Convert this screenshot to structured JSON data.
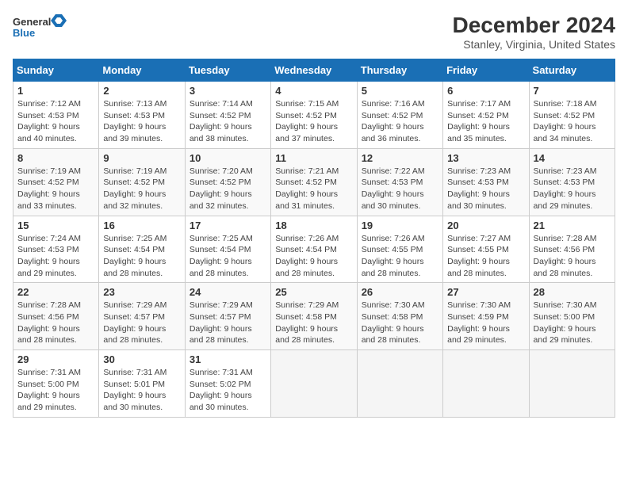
{
  "header": {
    "logo_line1": "General",
    "logo_line2": "Blue",
    "title": "December 2024",
    "subtitle": "Stanley, Virginia, United States"
  },
  "columns": [
    "Sunday",
    "Monday",
    "Tuesday",
    "Wednesday",
    "Thursday",
    "Friday",
    "Saturday"
  ],
  "weeks": [
    [
      {
        "day": "1",
        "sunrise": "7:12 AM",
        "sunset": "4:53 PM",
        "daylight": "9 hours and 40 minutes."
      },
      {
        "day": "2",
        "sunrise": "7:13 AM",
        "sunset": "4:53 PM",
        "daylight": "9 hours and 39 minutes."
      },
      {
        "day": "3",
        "sunrise": "7:14 AM",
        "sunset": "4:52 PM",
        "daylight": "9 hours and 38 minutes."
      },
      {
        "day": "4",
        "sunrise": "7:15 AM",
        "sunset": "4:52 PM",
        "daylight": "9 hours and 37 minutes."
      },
      {
        "day": "5",
        "sunrise": "7:16 AM",
        "sunset": "4:52 PM",
        "daylight": "9 hours and 36 minutes."
      },
      {
        "day": "6",
        "sunrise": "7:17 AM",
        "sunset": "4:52 PM",
        "daylight": "9 hours and 35 minutes."
      },
      {
        "day": "7",
        "sunrise": "7:18 AM",
        "sunset": "4:52 PM",
        "daylight": "9 hours and 34 minutes."
      }
    ],
    [
      {
        "day": "8",
        "sunrise": "7:19 AM",
        "sunset": "4:52 PM",
        "daylight": "9 hours and 33 minutes."
      },
      {
        "day": "9",
        "sunrise": "7:19 AM",
        "sunset": "4:52 PM",
        "daylight": "9 hours and 32 minutes."
      },
      {
        "day": "10",
        "sunrise": "7:20 AM",
        "sunset": "4:52 PM",
        "daylight": "9 hours and 32 minutes."
      },
      {
        "day": "11",
        "sunrise": "7:21 AM",
        "sunset": "4:52 PM",
        "daylight": "9 hours and 31 minutes."
      },
      {
        "day": "12",
        "sunrise": "7:22 AM",
        "sunset": "4:53 PM",
        "daylight": "9 hours and 30 minutes."
      },
      {
        "day": "13",
        "sunrise": "7:23 AM",
        "sunset": "4:53 PM",
        "daylight": "9 hours and 30 minutes."
      },
      {
        "day": "14",
        "sunrise": "7:23 AM",
        "sunset": "4:53 PM",
        "daylight": "9 hours and 29 minutes."
      }
    ],
    [
      {
        "day": "15",
        "sunrise": "7:24 AM",
        "sunset": "4:53 PM",
        "daylight": "9 hours and 29 minutes."
      },
      {
        "day": "16",
        "sunrise": "7:25 AM",
        "sunset": "4:54 PM",
        "daylight": "9 hours and 28 minutes."
      },
      {
        "day": "17",
        "sunrise": "7:25 AM",
        "sunset": "4:54 PM",
        "daylight": "9 hours and 28 minutes."
      },
      {
        "day": "18",
        "sunrise": "7:26 AM",
        "sunset": "4:54 PM",
        "daylight": "9 hours and 28 minutes."
      },
      {
        "day": "19",
        "sunrise": "7:26 AM",
        "sunset": "4:55 PM",
        "daylight": "9 hours and 28 minutes."
      },
      {
        "day": "20",
        "sunrise": "7:27 AM",
        "sunset": "4:55 PM",
        "daylight": "9 hours and 28 minutes."
      },
      {
        "day": "21",
        "sunrise": "7:28 AM",
        "sunset": "4:56 PM",
        "daylight": "9 hours and 28 minutes."
      }
    ],
    [
      {
        "day": "22",
        "sunrise": "7:28 AM",
        "sunset": "4:56 PM",
        "daylight": "9 hours and 28 minutes."
      },
      {
        "day": "23",
        "sunrise": "7:29 AM",
        "sunset": "4:57 PM",
        "daylight": "9 hours and 28 minutes."
      },
      {
        "day": "24",
        "sunrise": "7:29 AM",
        "sunset": "4:57 PM",
        "daylight": "9 hours and 28 minutes."
      },
      {
        "day": "25",
        "sunrise": "7:29 AM",
        "sunset": "4:58 PM",
        "daylight": "9 hours and 28 minutes."
      },
      {
        "day": "26",
        "sunrise": "7:30 AM",
        "sunset": "4:58 PM",
        "daylight": "9 hours and 28 minutes."
      },
      {
        "day": "27",
        "sunrise": "7:30 AM",
        "sunset": "4:59 PM",
        "daylight": "9 hours and 29 minutes."
      },
      {
        "day": "28",
        "sunrise": "7:30 AM",
        "sunset": "5:00 PM",
        "daylight": "9 hours and 29 minutes."
      }
    ],
    [
      {
        "day": "29",
        "sunrise": "7:31 AM",
        "sunset": "5:00 PM",
        "daylight": "9 hours and 29 minutes."
      },
      {
        "day": "30",
        "sunrise": "7:31 AM",
        "sunset": "5:01 PM",
        "daylight": "9 hours and 30 minutes."
      },
      {
        "day": "31",
        "sunrise": "7:31 AM",
        "sunset": "5:02 PM",
        "daylight": "9 hours and 30 minutes."
      },
      null,
      null,
      null,
      null
    ]
  ],
  "labels": {
    "sunrise_prefix": "Sunrise: ",
    "sunset_prefix": "Sunset: ",
    "daylight_prefix": "Daylight: "
  }
}
